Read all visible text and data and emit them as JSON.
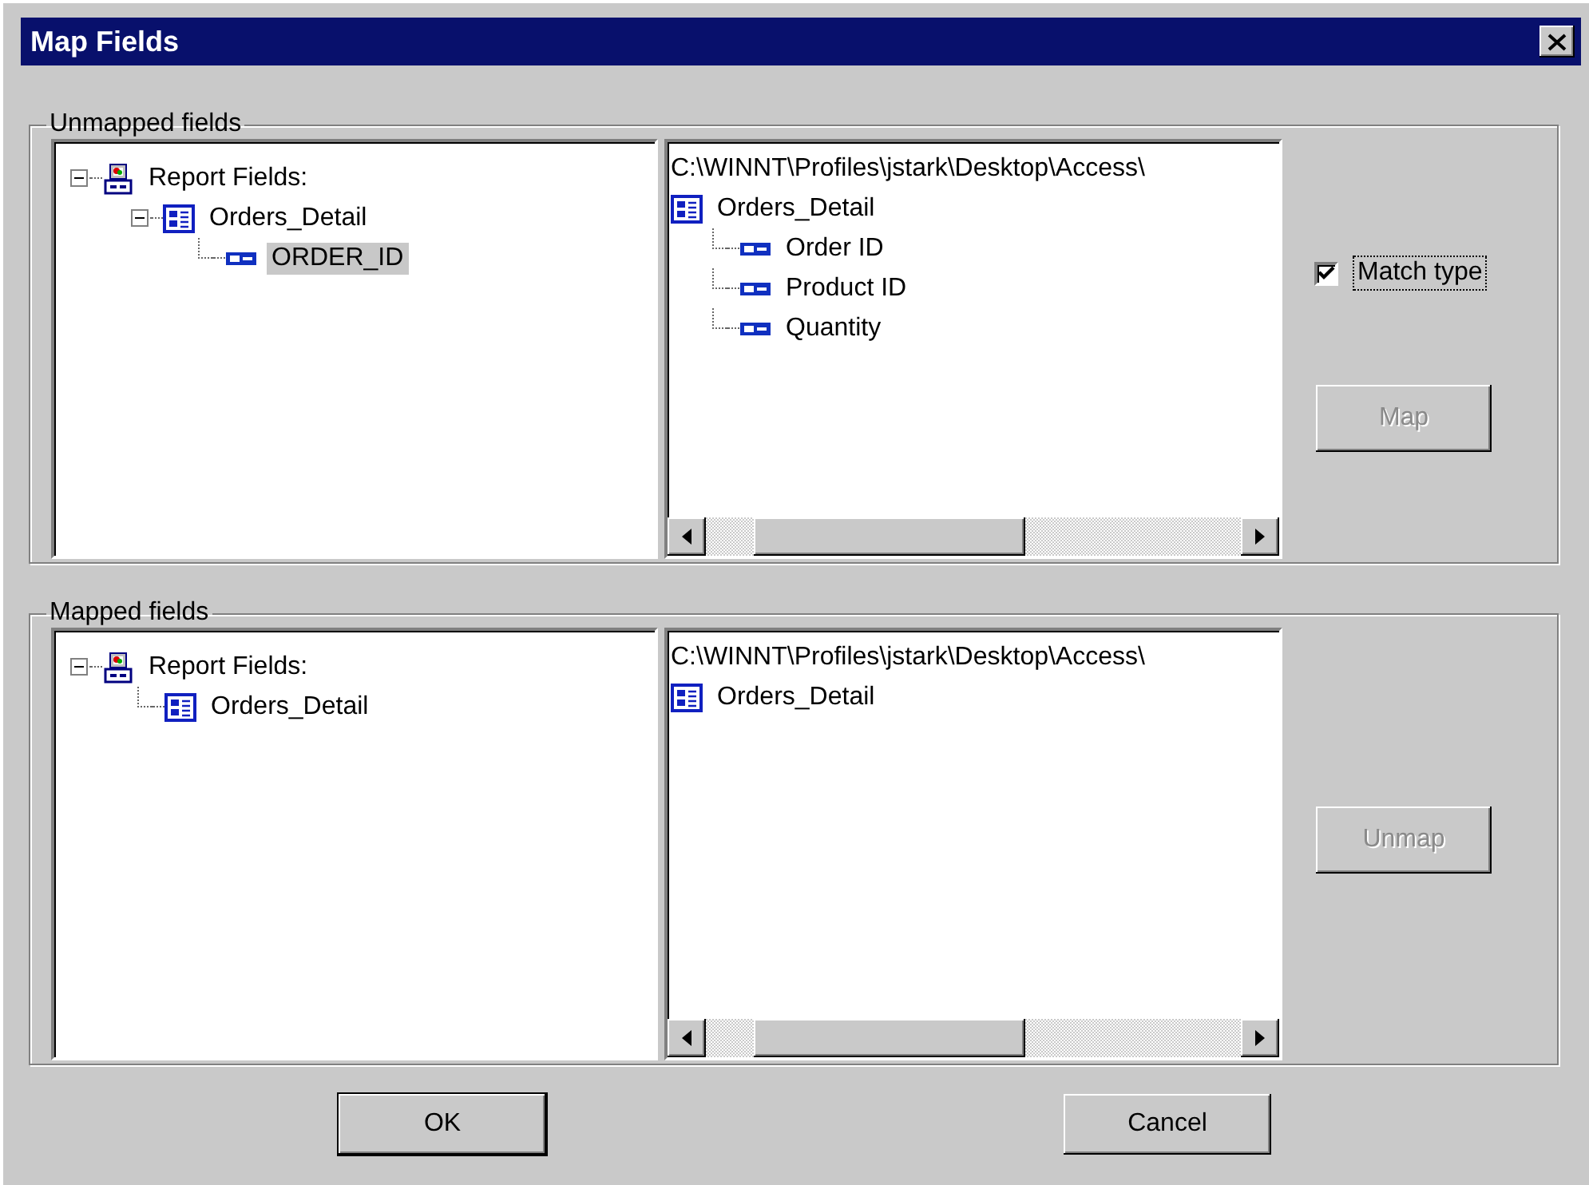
{
  "window": {
    "title": "Map Fields"
  },
  "groups": [
    {
      "label": "Unmapped fields",
      "report_tree": [
        {
          "label": "Report Fields:",
          "kind": "report",
          "expanded": true,
          "selected": false,
          "children": [
            {
              "label": "Orders_Detail",
              "kind": "table",
              "expanded": true,
              "selected": false,
              "children": [
                {
                  "label": "ORDER_ID",
                  "kind": "field",
                  "selected": true
                }
              ]
            }
          ]
        }
      ],
      "source_path": "C:\\WINNT\\Profiles\\jstark\\Desktop\\Access\\",
      "source_tree": [
        {
          "label": "Orders_Detail",
          "kind": "table",
          "selected": false,
          "children": [
            {
              "label": "Order ID",
              "kind": "field",
              "selected": false
            },
            {
              "label": "Product ID",
              "kind": "field",
              "selected": false
            },
            {
              "label": "Quantity",
              "kind": "field",
              "selected": false
            }
          ]
        }
      ],
      "checkbox": {
        "label": "Match type",
        "checked": true
      },
      "button": {
        "label": "Map",
        "disabled": true
      }
    },
    {
      "label": "Mapped fields",
      "report_tree": [
        {
          "label": "Report Fields:",
          "kind": "report",
          "expanded": true,
          "selected": false,
          "children": [
            {
              "label": "Orders_Detail",
              "kind": "table",
              "selected": false
            }
          ]
        }
      ],
      "source_path": "C:\\WINNT\\Profiles\\jstark\\Desktop\\Access\\",
      "source_tree": [
        {
          "label": "Orders_Detail",
          "kind": "table",
          "selected": false
        }
      ],
      "button": {
        "label": "Unmap",
        "disabled": true
      }
    }
  ],
  "buttons": [
    {
      "label": "OK",
      "default": true
    },
    {
      "label": "Cancel",
      "default": false
    }
  ]
}
